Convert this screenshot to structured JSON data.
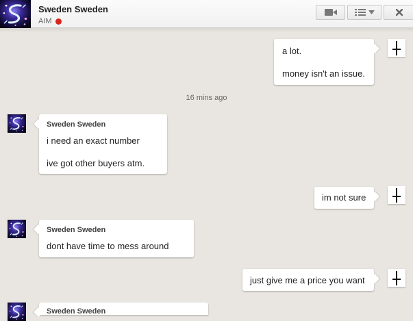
{
  "header": {
    "contact_name": "Sweden Sweden",
    "service": "AIM",
    "status_color": "#d9261c",
    "buttons": [
      "video-call-icon",
      "menu-icon",
      "close-icon"
    ]
  },
  "conversation": {
    "timestamp": "16 mins ago",
    "messages": [
      {
        "direction": "outgoing",
        "lines": [
          "a lot.",
          "money isn't an issue."
        ]
      },
      {
        "direction": "incoming",
        "sender": "Sweden Sweden",
        "lines": [
          "i need an exact number",
          "ive got other buyers atm."
        ]
      },
      {
        "direction": "outgoing",
        "lines": [
          "im not sure"
        ]
      },
      {
        "direction": "incoming",
        "sender": "Sweden Sweden",
        "lines": [
          "dont have time to mess around"
        ]
      },
      {
        "direction": "outgoing",
        "lines": [
          "just give me a price you want"
        ]
      },
      {
        "direction": "incoming",
        "sender": "Sweden Sweden",
        "lines": []
      }
    ]
  }
}
